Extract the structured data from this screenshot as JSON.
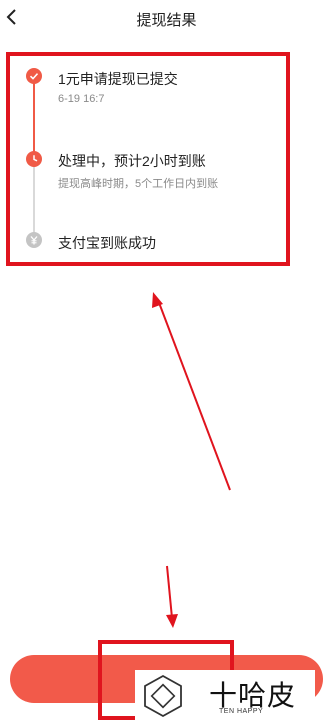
{
  "header": {
    "title": "提现结果",
    "back_icon": "chevron-left-icon"
  },
  "steps": [
    {
      "title": "1元申请提现已提交",
      "subtitle": "6-19 16:7",
      "status": "done",
      "icon": "check-icon",
      "color": "#f05a46"
    },
    {
      "title": "处理中，预计2小时到账",
      "subtitle": "提现高峰时期，5个工作日内到账",
      "status": "in-progress",
      "icon": "clock-icon",
      "color": "#f05a46"
    },
    {
      "title": "支付宝到账成功",
      "subtitle": "",
      "status": "pending",
      "icon": "yen-icon",
      "color": "#c4c4c4"
    }
  ],
  "footer": {
    "button_color": "#f25a4a"
  },
  "watermark": {
    "text": "十哈皮",
    "sub": "TEN HAPPY"
  },
  "annotation_color": "#e0141e"
}
